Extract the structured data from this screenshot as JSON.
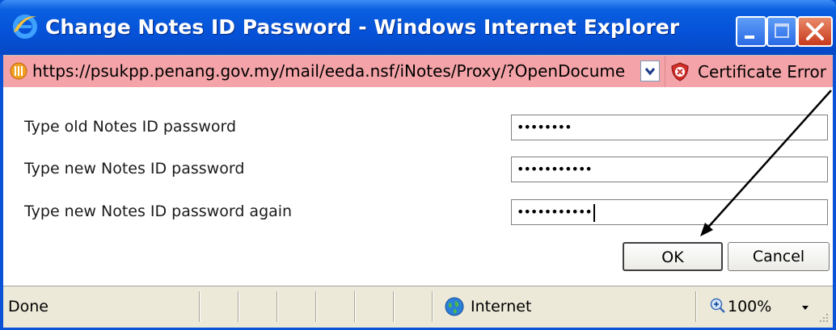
{
  "window": {
    "title": "Change Notes ID Password - Windows Internet Explorer",
    "title_icon": "ie-logo-icon",
    "controls": [
      "minimize-icon",
      "maximize-icon",
      "close-icon"
    ]
  },
  "address_bar": {
    "url": "https://psukpp.penang.gov.my/mail/eeda.nsf/iNotes/Proxy/?OpenDocume",
    "certificate_label": "Certificate Error",
    "background_color": "#f4a4a8"
  },
  "form": {
    "fields": [
      {
        "label": "Type old Notes ID password",
        "value": "••••••••"
      },
      {
        "label": "Type new Notes ID password",
        "value": "•••••••••••"
      },
      {
        "label": "Type new Notes ID password again",
        "value": "•••••••••••"
      }
    ],
    "ok_label": "OK",
    "cancel_label": "Cancel"
  },
  "status_bar": {
    "status": "Done",
    "zone": "Internet",
    "zoom": "100%"
  }
}
